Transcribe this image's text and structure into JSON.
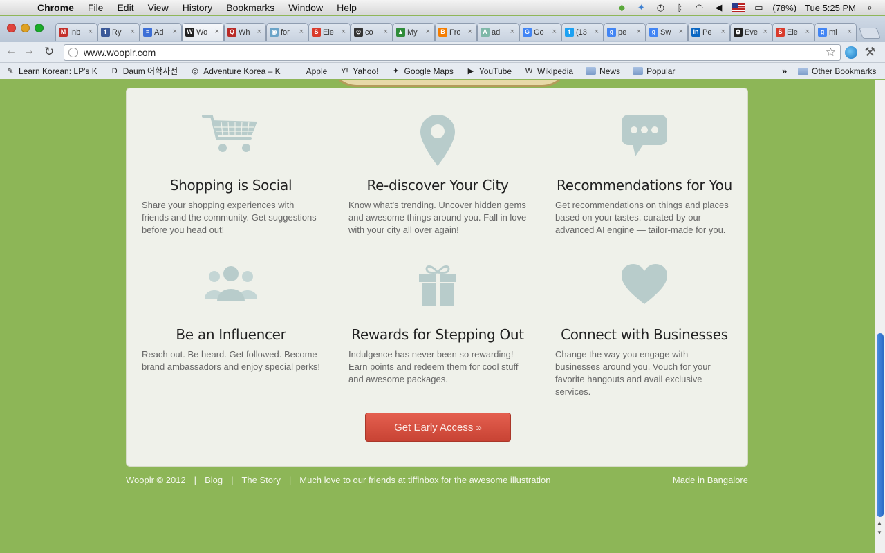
{
  "menubar": {
    "app": "Chrome",
    "items": [
      "File",
      "Edit",
      "View",
      "History",
      "Bookmarks",
      "Window",
      "Help"
    ],
    "battery": "(78%)",
    "clock": "Tue 5:25 PM"
  },
  "tabs": [
    {
      "title": "Inb",
      "color": "#c4302b",
      "glyph": "M"
    },
    {
      "title": "Ry",
      "color": "#3b5998",
      "glyph": "f"
    },
    {
      "title": "Ad",
      "color": "#3d6fd6",
      "glyph": "≡"
    },
    {
      "title": "Wo",
      "color": "#222222",
      "glyph": "W"
    },
    {
      "title": "Wh",
      "color": "#b92b27",
      "glyph": "Q"
    },
    {
      "title": "for",
      "color": "#6ba4c8",
      "glyph": "◉"
    },
    {
      "title": "Ele",
      "color": "#d93a2b",
      "glyph": "S"
    },
    {
      "title": "co",
      "color": "#333333",
      "glyph": "⊙"
    },
    {
      "title": "My",
      "color": "#2f8c3a",
      "glyph": "▲"
    },
    {
      "title": "Fro",
      "color": "#f57d00",
      "glyph": "B"
    },
    {
      "title": "ad",
      "color": "#7fb8a8",
      "glyph": "A"
    },
    {
      "title": "Go",
      "color": "#4285f4",
      "glyph": "G"
    },
    {
      "title": "(13",
      "color": "#1da1f2",
      "glyph": "t"
    },
    {
      "title": "pe",
      "color": "#4285f4",
      "glyph": "g"
    },
    {
      "title": "Sw",
      "color": "#4285f4",
      "glyph": "g"
    },
    {
      "title": "Pe",
      "color": "#0a66c2",
      "glyph": "in"
    },
    {
      "title": "Eve",
      "color": "#222222",
      "glyph": "✿"
    },
    {
      "title": "Ele",
      "color": "#d93a2b",
      "glyph": "S"
    },
    {
      "title": "mi",
      "color": "#4285f4",
      "glyph": "g"
    }
  ],
  "active_tab_index": 3,
  "address": "www.wooplr.com",
  "bookmarks": [
    {
      "label": "Learn Korean: LP's K",
      "icon": "✎"
    },
    {
      "label": "Daum 어학사전",
      "icon": "D"
    },
    {
      "label": "Adventure Korea – K",
      "icon": "◎"
    },
    {
      "label": "Apple",
      "icon": ""
    },
    {
      "label": "Yahoo!",
      "icon": "Y!"
    },
    {
      "label": "Google Maps",
      "icon": "✦"
    },
    {
      "label": "YouTube",
      "icon": "▶"
    },
    {
      "label": "Wikipedia",
      "icon": "W"
    },
    {
      "label": "News",
      "icon": "folder"
    },
    {
      "label": "Popular",
      "icon": "folder"
    }
  ],
  "bookmarks_more": "»",
  "other_bookmarks": "Other Bookmarks",
  "features": [
    {
      "title": "Shopping is Social",
      "icon": "cart-icon",
      "text": "Share your shopping experiences with friends and the community. Get suggestions before you head out!"
    },
    {
      "title": "Re-discover Your City",
      "icon": "map-pin-icon",
      "text": "Know what's trending. Uncover hidden gems and awesome things around you. Fall in love with your city all over again!"
    },
    {
      "title": "Recommendations for You",
      "icon": "speech-bubble-icon",
      "text": "Get recommendations on things and places based on your tastes, curated by our advanced AI engine — tailor-made for you."
    },
    {
      "title": "Be an Influencer",
      "icon": "people-icon",
      "text": "Reach out. Be heard. Get followed. Become brand ambassadors and enjoy special perks!"
    },
    {
      "title": "Rewards for Stepping Out",
      "icon": "gift-icon",
      "text": "Indulgence has never been so rewarding! Earn points and redeem them for cool stuff and awesome packages."
    },
    {
      "title": "Connect with Businesses",
      "icon": "heart-icon",
      "text": "Change the way you engage with businesses around you. Vouch for your favorite hangouts and avail exclusive services."
    }
  ],
  "cta": "Get Early Access »",
  "footer": {
    "copyright": "Wooplr © 2012",
    "blog": "Blog",
    "story": "The Story",
    "credit": "Much love to our friends at tiffinbox for the awesome illustration",
    "made": "Made in Bangalore",
    "sep": "|"
  },
  "colors": {
    "background": "#8db657",
    "card": "#eff1ea",
    "icon": "#b8cccb",
    "cta": "#d54e3f"
  }
}
